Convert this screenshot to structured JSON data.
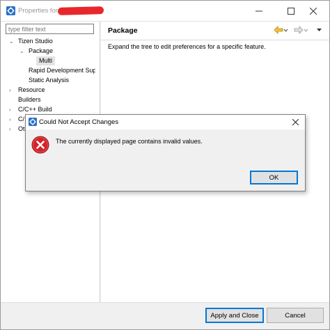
{
  "window": {
    "title": "Properties for",
    "buttons": {
      "minimize": "—",
      "maximize": "☐",
      "close": "✕"
    }
  },
  "filter": {
    "placeholder": "type filter text"
  },
  "tree": {
    "tizen_studio": "Tizen Studio",
    "package": "Package",
    "multi": "Multi",
    "rapid_dev": "Rapid Development Sup",
    "static_analysis": "Static Analysis",
    "resource": "Resource",
    "builders": "Builders",
    "cpp_build": "C/C++ Build",
    "cpp_partial": "C/",
    "other_partial": "Ot"
  },
  "page": {
    "title": "Package",
    "description": "Expand the tree to edit preferences for a specific feature."
  },
  "buttons": {
    "apply_close": "Apply and Close",
    "cancel": "Cancel"
  },
  "dialog": {
    "title": "Could Not Accept Changes",
    "message": "The currently displayed page contains invalid values.",
    "ok": "OK"
  },
  "icons": {
    "app": "tizen-gear-icon",
    "error": "error-x-icon",
    "nav_back": "back-arrow-icon",
    "nav_forward": "forward-arrow-icon",
    "menu": "view-menu-icon"
  },
  "colors": {
    "accent": "#0078d7",
    "error": "#d3242a",
    "redaction": "#e8272c"
  }
}
